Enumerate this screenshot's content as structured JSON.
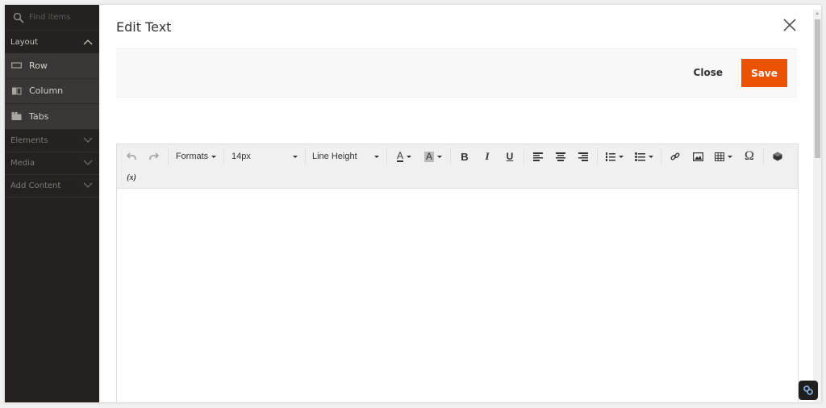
{
  "sidebar": {
    "search_placeholder": "Find items",
    "groups": [
      {
        "label": "Layout",
        "expanded": true,
        "items": [
          {
            "label": "Row",
            "icon": "row-icon"
          },
          {
            "label": "Column",
            "icon": "column-icon"
          },
          {
            "label": "Tabs",
            "icon": "tabs-icon"
          }
        ]
      },
      {
        "label": "Elements",
        "expanded": false
      },
      {
        "label": "Media",
        "expanded": false
      },
      {
        "label": "Add Content",
        "expanded": false
      }
    ]
  },
  "modal": {
    "title": "Edit Text",
    "close_label": "Close",
    "save_label": "Save",
    "accent_color": "#eb5202"
  },
  "toolbar": {
    "formats_label": "Formats",
    "font_size_value": "14px",
    "line_height_label": "Line Height",
    "text_color_glyph": "A",
    "bg_color_glyph": "A",
    "bold_glyph": "B",
    "italic_glyph": "I",
    "underline_glyph": "U",
    "special_char_glyph": "Ω",
    "variable_glyph": "(x)"
  }
}
